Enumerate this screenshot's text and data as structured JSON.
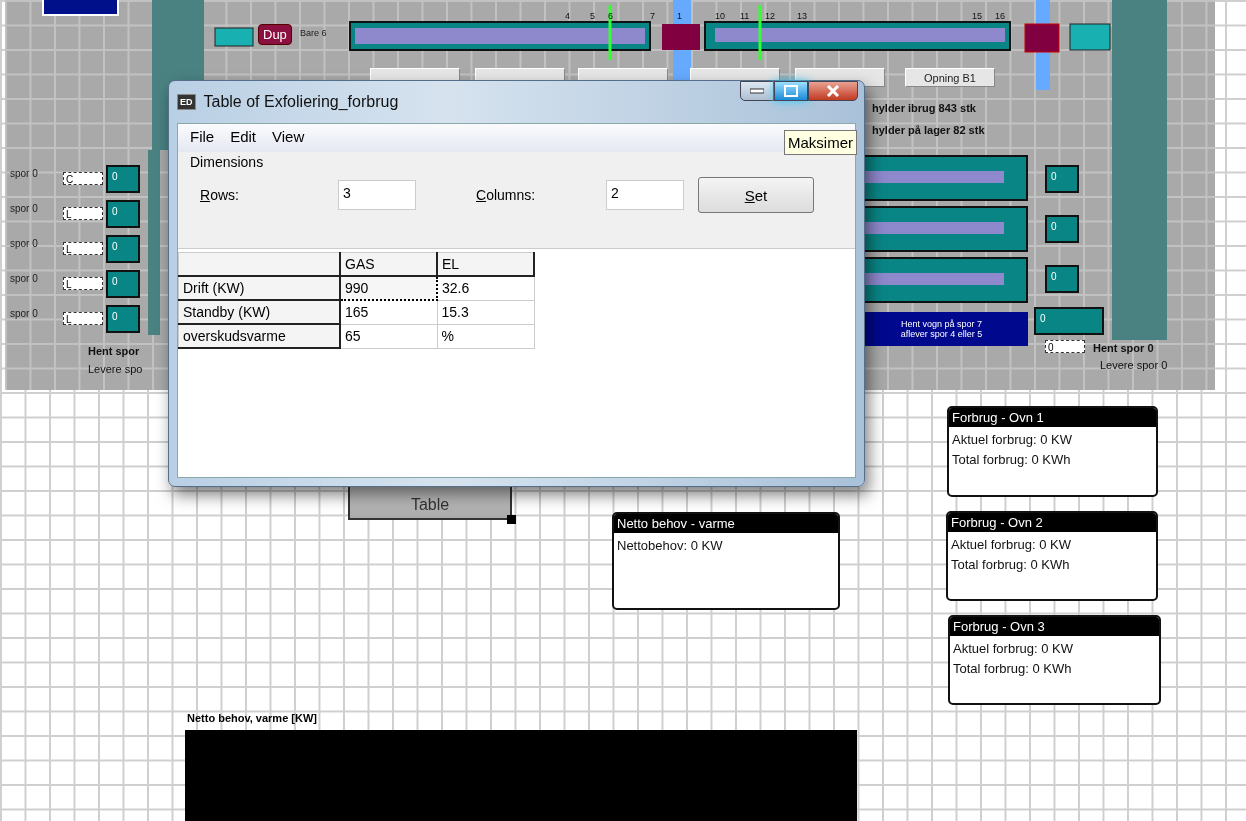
{
  "panel": {
    "tag": "Dup",
    "bar_label": "Bare 6",
    "track_numbers": [
      "4",
      "5",
      "6",
      "7",
      "1",
      "10",
      "11",
      "12",
      "13",
      "15",
      "16"
    ],
    "buttons": [
      {
        "kind": "blank"
      },
      {
        "kind": "blank"
      },
      {
        "kind": "blank"
      },
      {
        "kind": "blank"
      },
      {
        "kind": "blank"
      },
      {
        "kind": "labeled",
        "label": "Opning B1"
      }
    ],
    "shelves_in_use": "hylder ibrug 843 stk",
    "shelves_in_stock": "hylder på lager 82 stk",
    "left_tracks": [
      {
        "label": "spor 0",
        "field": "C",
        "count": "0"
      },
      {
        "label": "spor 0",
        "field": "L",
        "count": "0"
      },
      {
        "label": "spor 0",
        "field": "L",
        "count": "0"
      },
      {
        "label": "spor 0",
        "field": "L",
        "count": "0"
      },
      {
        "label": "spor 0",
        "field": "L",
        "count": "0"
      }
    ],
    "left_pickup": "Hent spor",
    "left_delivery": "Levere spo",
    "right_counts": [
      "0",
      "0",
      "0",
      "0"
    ],
    "instruction": [
      "Hent vogn på spor 7",
      "aflever spor 4 eller 5"
    ],
    "right_field": "0",
    "right_pickup": "Hent spor 0",
    "right_delivery": "Levere spor 0"
  },
  "dialog": {
    "app_icon": "ED",
    "title": "Table of Exfoliering_forbrug",
    "tooltip": "Maksimer",
    "menu": [
      "File",
      "Edit",
      "View"
    ],
    "group": "Dimensions",
    "rows_label": "Rows:",
    "rows_value": "3",
    "columns_label": "Columns:",
    "columns_value": "2",
    "set_button": "Set",
    "table": {
      "columns": [
        "GAS",
        "EL"
      ],
      "rows": [
        {
          "label": "Drift (KW)",
          "cells": [
            {
              "text": "990",
              "focused": true
            },
            {
              "text": "32.6",
              "focused": false
            }
          ]
        },
        {
          "label": "Standby (KW)",
          "cells": [
            {
              "text": "165",
              "focused": false
            },
            {
              "text": "15.3",
              "focused": false
            }
          ]
        },
        {
          "label": "overskudsvarme",
          "cells": [
            {
              "text": "65",
              "focused": false
            },
            {
              "text": "%",
              "focused": false
            }
          ]
        }
      ]
    }
  },
  "canvas": {
    "table_block": "Table",
    "monitors": [
      {
        "title": "Netto behov - varme",
        "lines": [
          "Nettobehov: 0 KW"
        ]
      },
      {
        "title": "Forbrug - Ovn 1",
        "lines": [
          "Aktuel forbrug: 0 KW",
          "Total forbrug: 0 KWh"
        ]
      },
      {
        "title": "Forbrug - Ovn 2",
        "lines": [
          "Aktuel forbrug: 0 KW",
          "Total forbrug: 0 KWh"
        ]
      },
      {
        "title": "Forbrug - Ovn 3",
        "lines": [
          "Aktuel forbrug: 0 KW",
          "Total forbrug: 0 KWh"
        ]
      }
    ],
    "chart_label": "Netto behov, varme [KW]"
  }
}
